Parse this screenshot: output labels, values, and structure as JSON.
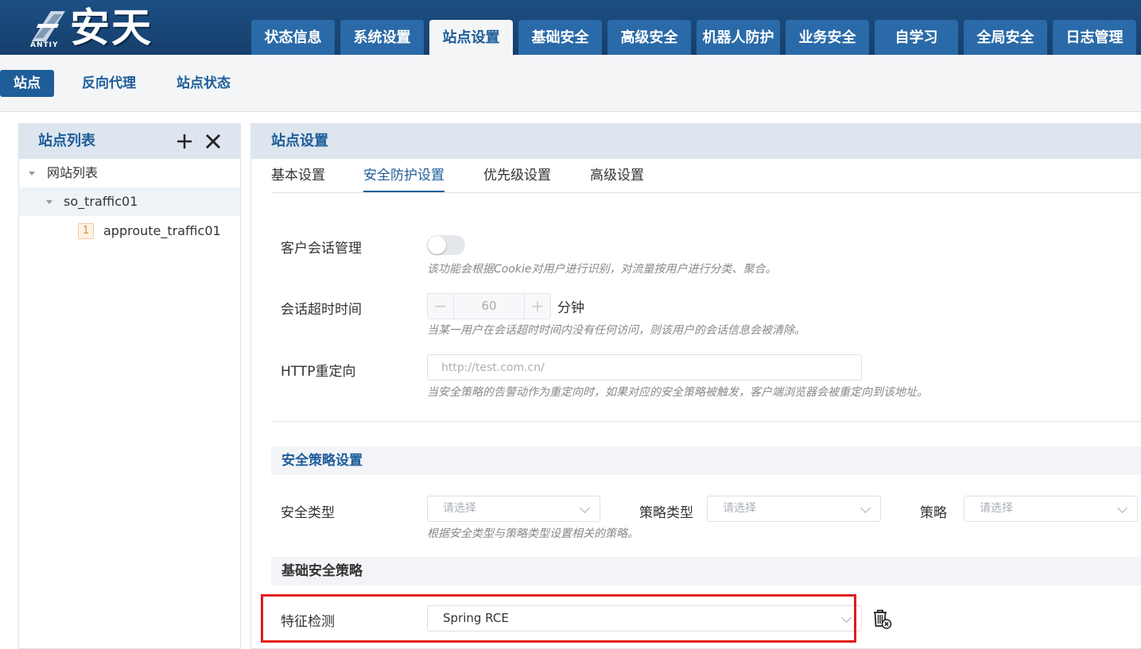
{
  "app": {
    "logo_text": "安天",
    "logo_sub": "ANTIY"
  },
  "main_tabs": [
    "状态信息",
    "系统设置",
    "站点设置",
    "基础安全",
    "高级安全",
    "机器人防护",
    "业务安全",
    "自学习",
    "全局安全",
    "日志管理"
  ],
  "main_tab_active": "站点设置",
  "subnav": {
    "items": [
      "站点",
      "反向代理",
      "站点状态"
    ],
    "active": "站点"
  },
  "sidebar": {
    "title": "站点列表",
    "tree": [
      {
        "label": "网站列表",
        "level": 0
      },
      {
        "label": "so_traffic01",
        "level": 1,
        "selected": true
      },
      {
        "label": "approute_traffic01",
        "level": 2,
        "badge": "1"
      }
    ]
  },
  "panel": {
    "title": "站点设置",
    "tabs": [
      "基本设置",
      "安全防护设置",
      "优先级设置",
      "高级设置"
    ],
    "active_tab": "安全防护设置",
    "session": {
      "label": "客户会话管理",
      "enabled": false,
      "hint": "该功能会根据Cookie对用户进行识别，对流量按用户进行分类、聚合。"
    },
    "timeout": {
      "label": "会话超时时间",
      "value": "60",
      "unit": "分钟",
      "minus": "−",
      "plus": "+",
      "hint": "当某一用户在会话超时时间内没有任何访问，则该用户的会话信息会被清除。"
    },
    "redirect": {
      "label": "HTTP重定向",
      "placeholder": "http://test.com.cn/",
      "hint": "当安全策略的告警动作为重定向时，如果对应的安全策略被触发，客户端浏览器会被重定向到该地址。"
    },
    "policy_section": {
      "title": "安全策略设置",
      "security_type_label": "安全类型",
      "security_type_placeholder": "请选择",
      "policy_type_label": "策略类型",
      "policy_type_placeholder": "请选择",
      "policy_label": "策略",
      "policy_placeholder": "请选择",
      "hint": "根据安全类型与策略类型设置相关的策略。"
    },
    "basic_policy": {
      "title": "基础安全策略",
      "feature_label": "特征检测",
      "feature_value": "Spring RCE"
    }
  },
  "colors": {
    "header_bg": "#1d4f84",
    "accent": "#1e5d98",
    "highlight": "#e21b1b"
  }
}
